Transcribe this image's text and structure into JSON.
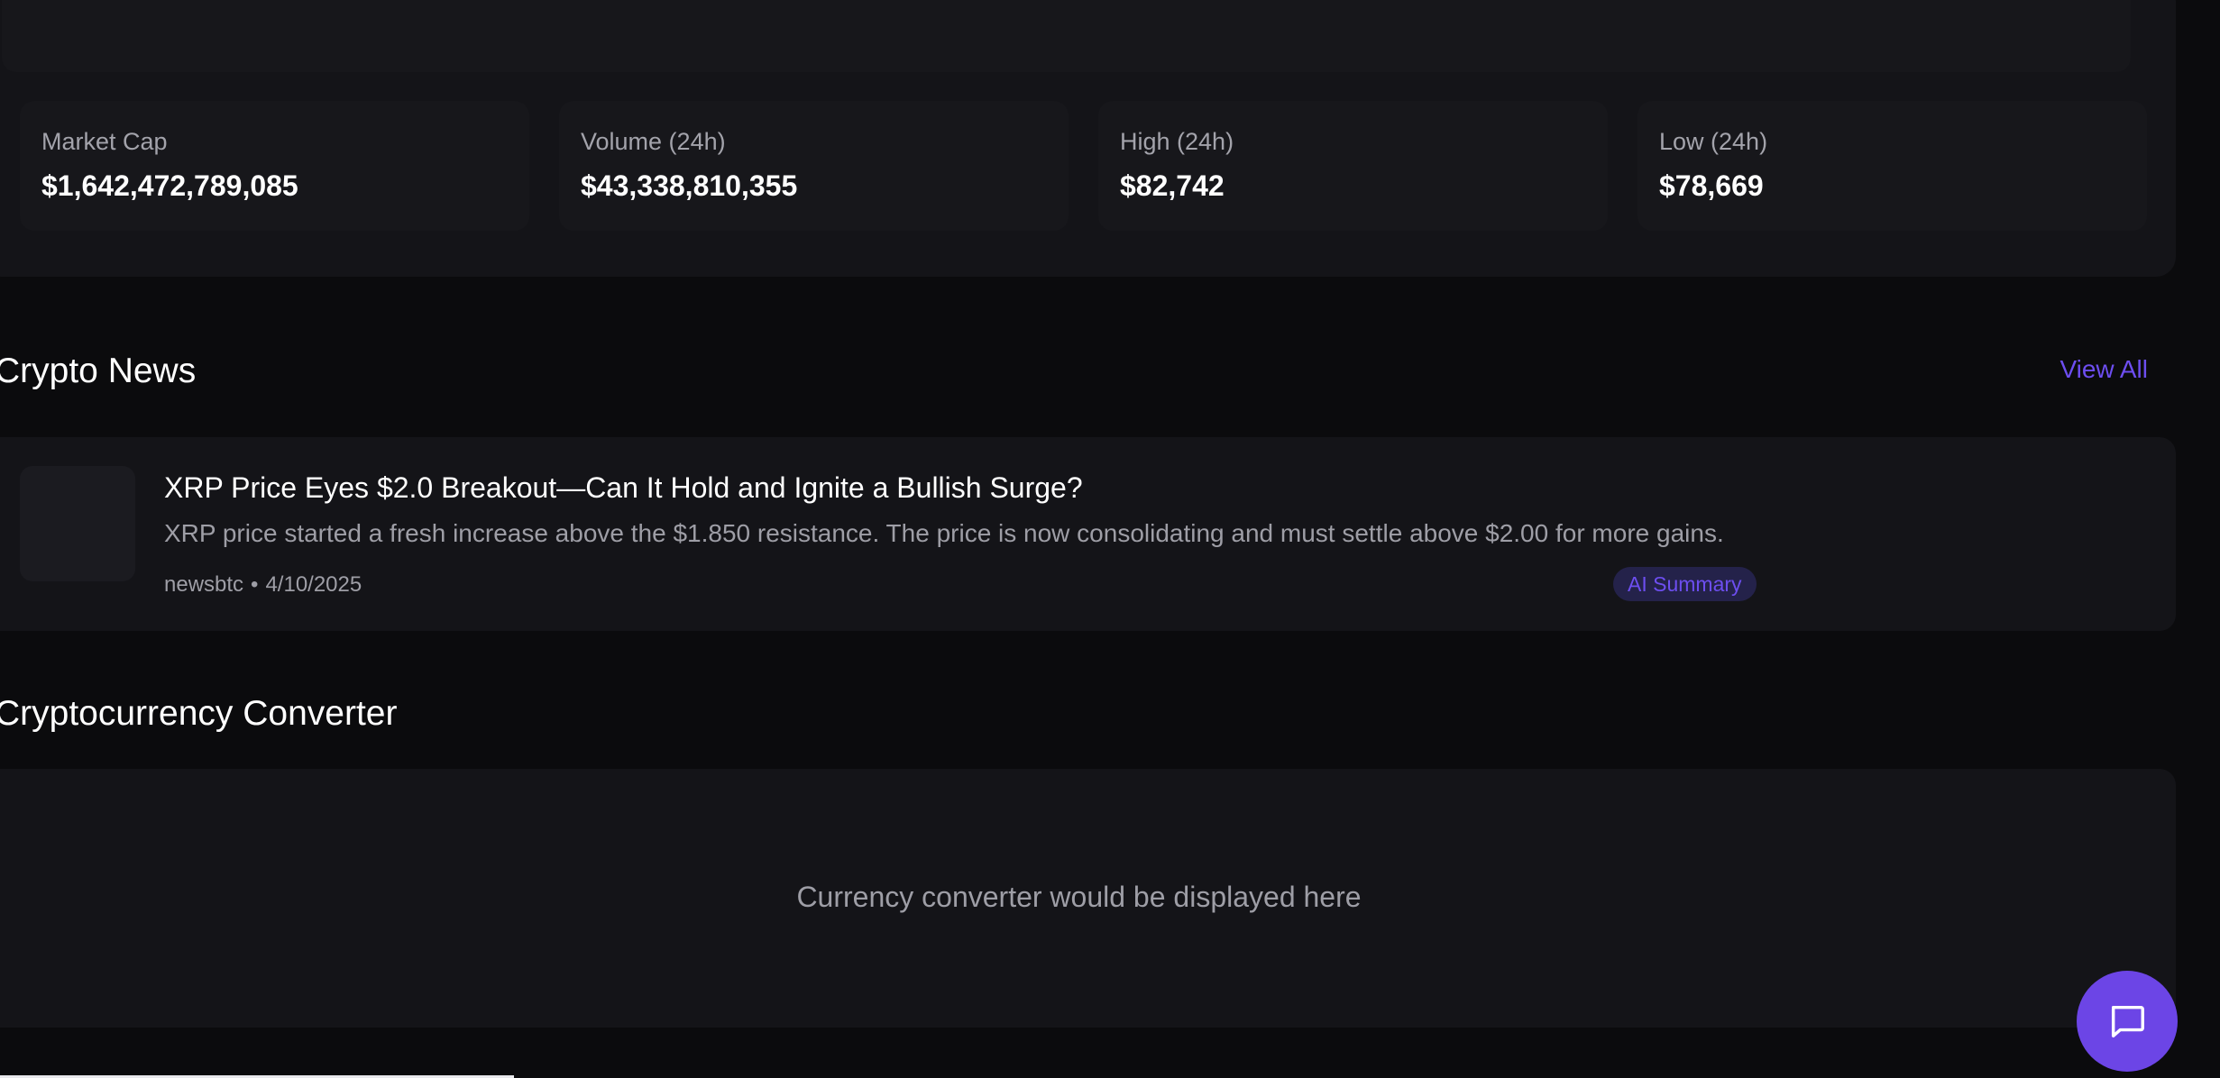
{
  "stats": [
    {
      "label": "Market Cap",
      "value": "$1,642,472,789,085"
    },
    {
      "label": "Volume (24h)",
      "value": "$43,338,810,355"
    },
    {
      "label": "High (24h)",
      "value": "$82,742"
    },
    {
      "label": "Low (24h)",
      "value": "$78,669"
    }
  ],
  "news_section": {
    "title": "Crypto News",
    "view_all": "View All",
    "items": [
      {
        "title": "XRP Price Eyes $2.0 Breakout—Can It Hold and Ignite a Bullish Surge?",
        "description": "XRP price started a fresh increase above the $1.850 resistance. The price is now consolidating and must settle above $2.00 for more gains.",
        "source": "newsbtc",
        "separator": "•",
        "date": "4/10/2025",
        "badge": "AI Summary"
      }
    ]
  },
  "converter": {
    "title": "Cryptocurrency Converter",
    "placeholder": "Currency converter would be displayed here"
  },
  "chat_button": {
    "icon": "chat-bubble-icon"
  },
  "colors": {
    "accent": "#6c45e6",
    "link": "#6d4ef0",
    "background": "#0b0b0d",
    "card": "#141418"
  }
}
